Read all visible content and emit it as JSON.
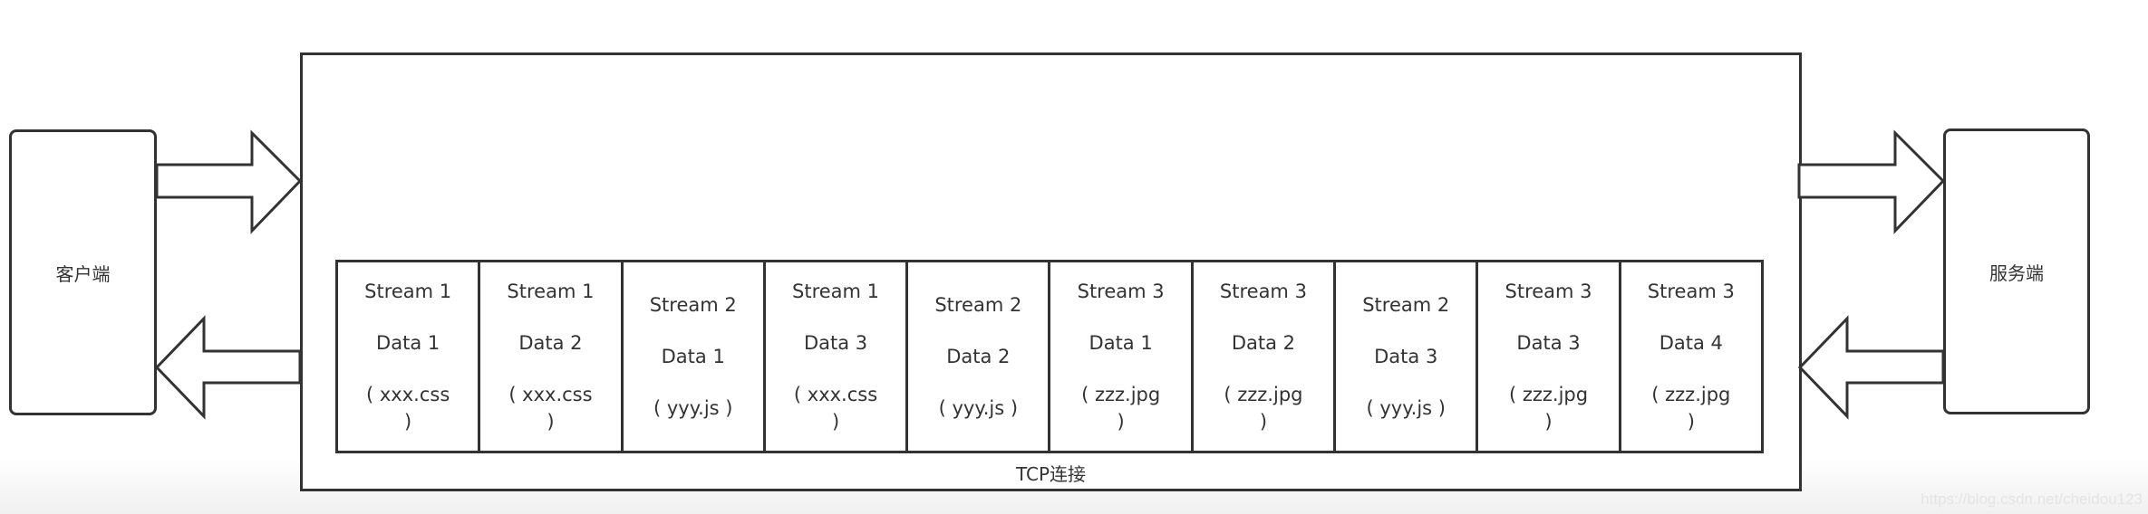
{
  "client_label": "客户端",
  "server_label": "服务端",
  "connection_label": "TCP连接",
  "watermark": "https://blog.csdn.net/cheidou123",
  "frames": [
    {
      "stream": "Stream 1",
      "data": "Data 1",
      "file_lines": [
        "( xxx.css",
        ")"
      ]
    },
    {
      "stream": "Stream 1",
      "data": "Data 2",
      "file_lines": [
        "( xxx.css",
        ")"
      ]
    },
    {
      "stream": "Stream 2",
      "data": "Data 1",
      "file_lines": [
        "( yyy.js )"
      ]
    },
    {
      "stream": "Stream 1",
      "data": "Data 3",
      "file_lines": [
        "( xxx.css",
        ")"
      ]
    },
    {
      "stream": "Stream 2",
      "data": "Data 2",
      "file_lines": [
        "( yyy.js )"
      ]
    },
    {
      "stream": "Stream 3",
      "data": "Data 1",
      "file_lines": [
        "( zzz.jpg",
        ")"
      ]
    },
    {
      "stream": "Stream 3",
      "data": "Data 2",
      "file_lines": [
        "( zzz.jpg",
        ")"
      ]
    },
    {
      "stream": "Stream 2",
      "data": "Data 3",
      "file_lines": [
        "( yyy.js )"
      ]
    },
    {
      "stream": "Stream 3",
      "data": "Data 3",
      "file_lines": [
        "( zzz.jpg",
        ")"
      ]
    },
    {
      "stream": "Stream 3",
      "data": "Data 4",
      "file_lines": [
        "( zzz.jpg",
        ")"
      ]
    }
  ],
  "colors": {
    "stroke": "#333333",
    "text": "#333333"
  }
}
